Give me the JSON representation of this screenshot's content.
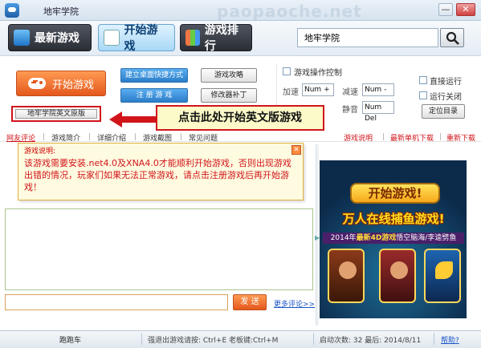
{
  "app": {
    "title": "地牢学院",
    "watermark": "paopaoche.net",
    "min_label": "—",
    "close_label": "✕"
  },
  "nav": {
    "newest": "最新游戏",
    "start": "开始游戏",
    "rank": "游戏排行"
  },
  "search": {
    "value": "地牢学院"
  },
  "controls": {
    "start_game": "开始游戏",
    "shortcut": "建立桌面快捷方式",
    "register": "注 册 游 戏",
    "guide": "游戏攻略",
    "patch": "修改器补丁",
    "english": "地牢学院英文原版",
    "callout": "点击此处开始英文版游戏",
    "game_ctrl_label": "游戏操作控制",
    "speedup_label": "加速",
    "speedup_value": "Num +",
    "slowdown_label": "减速",
    "slowdown_value": "Num -",
    "mute_label": "静音",
    "mute_value": "Num Del",
    "direct_run": "直接运行",
    "auto_close": "运行关闭",
    "locate_dir": "定位目录"
  },
  "tabs": [
    "网友评论",
    "游戏简介",
    "详细介绍",
    "游戏截图",
    "常见问题"
  ],
  "right_links": [
    "游戏说明",
    "最新单机下载",
    "重新下载"
  ],
  "notice": {
    "title": "游戏说明:",
    "body": "该游戏需要安装.net4.0及XNA4.0才能顺利开始游戏，否则出现游戏出错的情况，玩家们如果无法正常游戏，请点击注册游戏后再开始游戏！",
    "close": "✕"
  },
  "comment": {
    "send": "发 送",
    "more": "更多评论>>"
  },
  "poster": {
    "start": "开始游戏!",
    "title": "万人在线捕鱼游戏!",
    "sub_prefix": "2014年",
    "sub_highlight": "最新4D游戏",
    "sub_suffix": "悟空脑海/李逵劈鱼"
  },
  "status": {
    "runner": "跑跑车",
    "shortcuts": "强退出游戏请按: Ctrl+E 老板键:Ctrl+M",
    "launch_info": "启动次数: 32  最后: 2014/8/11",
    "help": "帮助?"
  },
  "colors": {
    "accent_orange": "#e4581c",
    "accent_red": "#d0141a",
    "link_blue": "#1a55c9"
  }
}
